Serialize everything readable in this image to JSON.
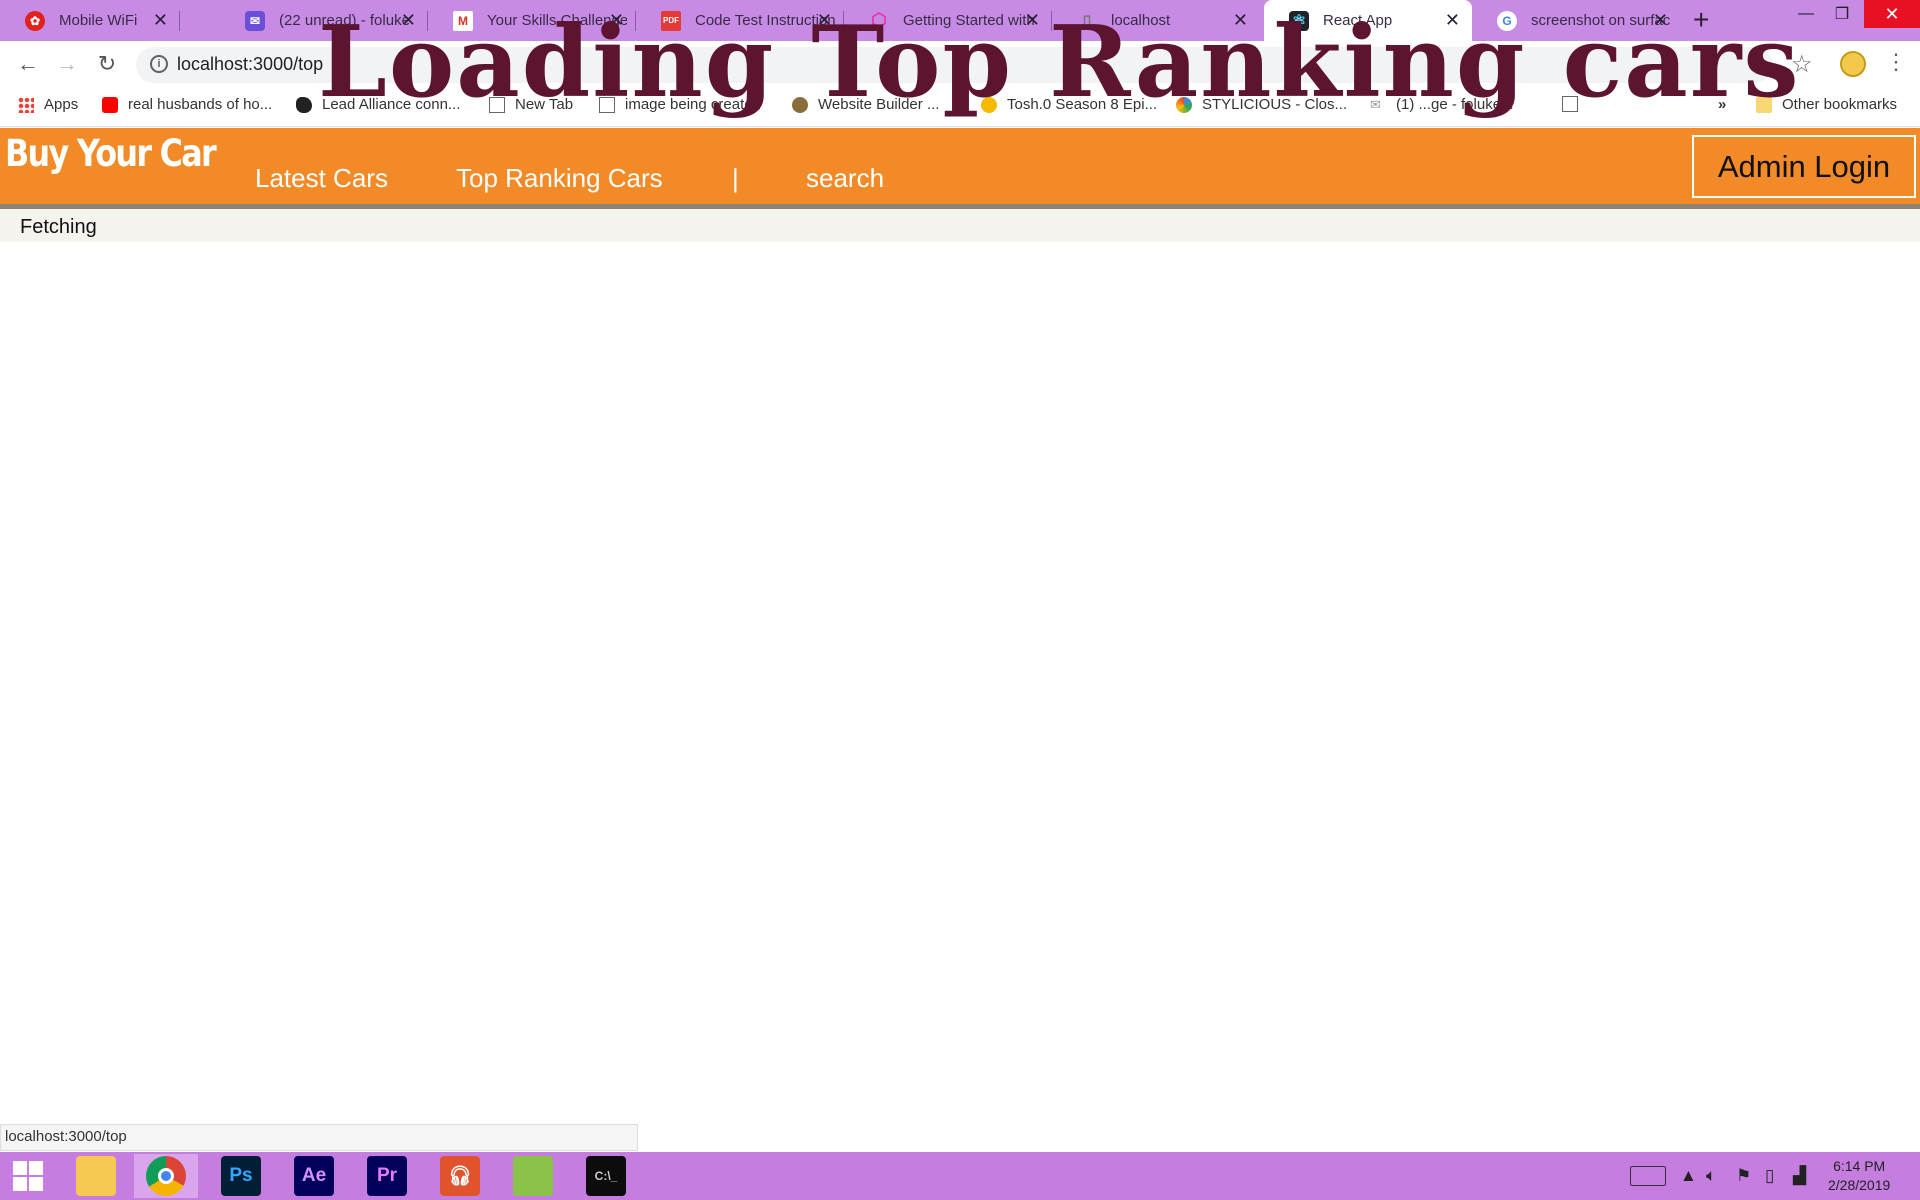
{
  "browser": {
    "tabs": [
      {
        "title": "Mobile WiFi",
        "icon": "huawei-icon",
        "color": "#e0211c"
      },
      {
        "title": "(22 unread) - foluke",
        "icon": "mail-icon",
        "color": "#6b4fd8"
      },
      {
        "title": "Your Skills Challenge",
        "icon": "gmail-icon",
        "color": "#d93025"
      },
      {
        "title": "Code Test Instructions",
        "icon": "pdf-icon",
        "color": "#e53935"
      },
      {
        "title": "Getting Started with",
        "icon": "graphql-icon",
        "color": "#e535ab"
      },
      {
        "title": "localhost",
        "icon": "page-icon",
        "color": "#888888"
      },
      {
        "title": "React App",
        "icon": "react-icon",
        "color": "#61dafb"
      },
      {
        "title": "screenshot on surface",
        "icon": "google-icon",
        "color": "#4285f4"
      }
    ],
    "url": "localhost:3000/top",
    "bookmarks": [
      "Apps",
      "real husbands of ho...",
      "Lead Alliance conn...",
      "New Tab",
      "image being created",
      "Website Builder ...",
      "Tosh.0 Season 8 Epi...",
      "STYLICIOUS - Clos...",
      "(1) ...ge - foluke...",
      "»",
      "Other bookmarks"
    ]
  },
  "overlay_title": "Loading Top Ranking cars",
  "app": {
    "brand": "Buy Your Car",
    "nav": [
      "Latest Cars",
      "Top Ranking Cars",
      "|",
      "search"
    ],
    "admin_label": "Admin Login",
    "status_message": "Fetching"
  },
  "status_bubble": "localhost:3000/top",
  "taskbar": {
    "apps": [
      {
        "name": "windows-start",
        "label": ""
      },
      {
        "name": "file-explorer",
        "label": ""
      },
      {
        "name": "chrome",
        "label": ""
      },
      {
        "name": "photoshop",
        "label": "Ps"
      },
      {
        "name": "after-effects",
        "label": "Ae"
      },
      {
        "name": "premiere",
        "label": "Pr"
      },
      {
        "name": "music-player",
        "label": ""
      },
      {
        "name": "notepad",
        "label": ""
      },
      {
        "name": "terminal",
        "label": ""
      }
    ],
    "time": "6:14 PM",
    "date": "2/28/2019"
  },
  "colors": {
    "tabstrip": "#c78be6",
    "navbar": "#f38a28",
    "overlay": "#5c1430",
    "taskbar": "#c57de0"
  }
}
